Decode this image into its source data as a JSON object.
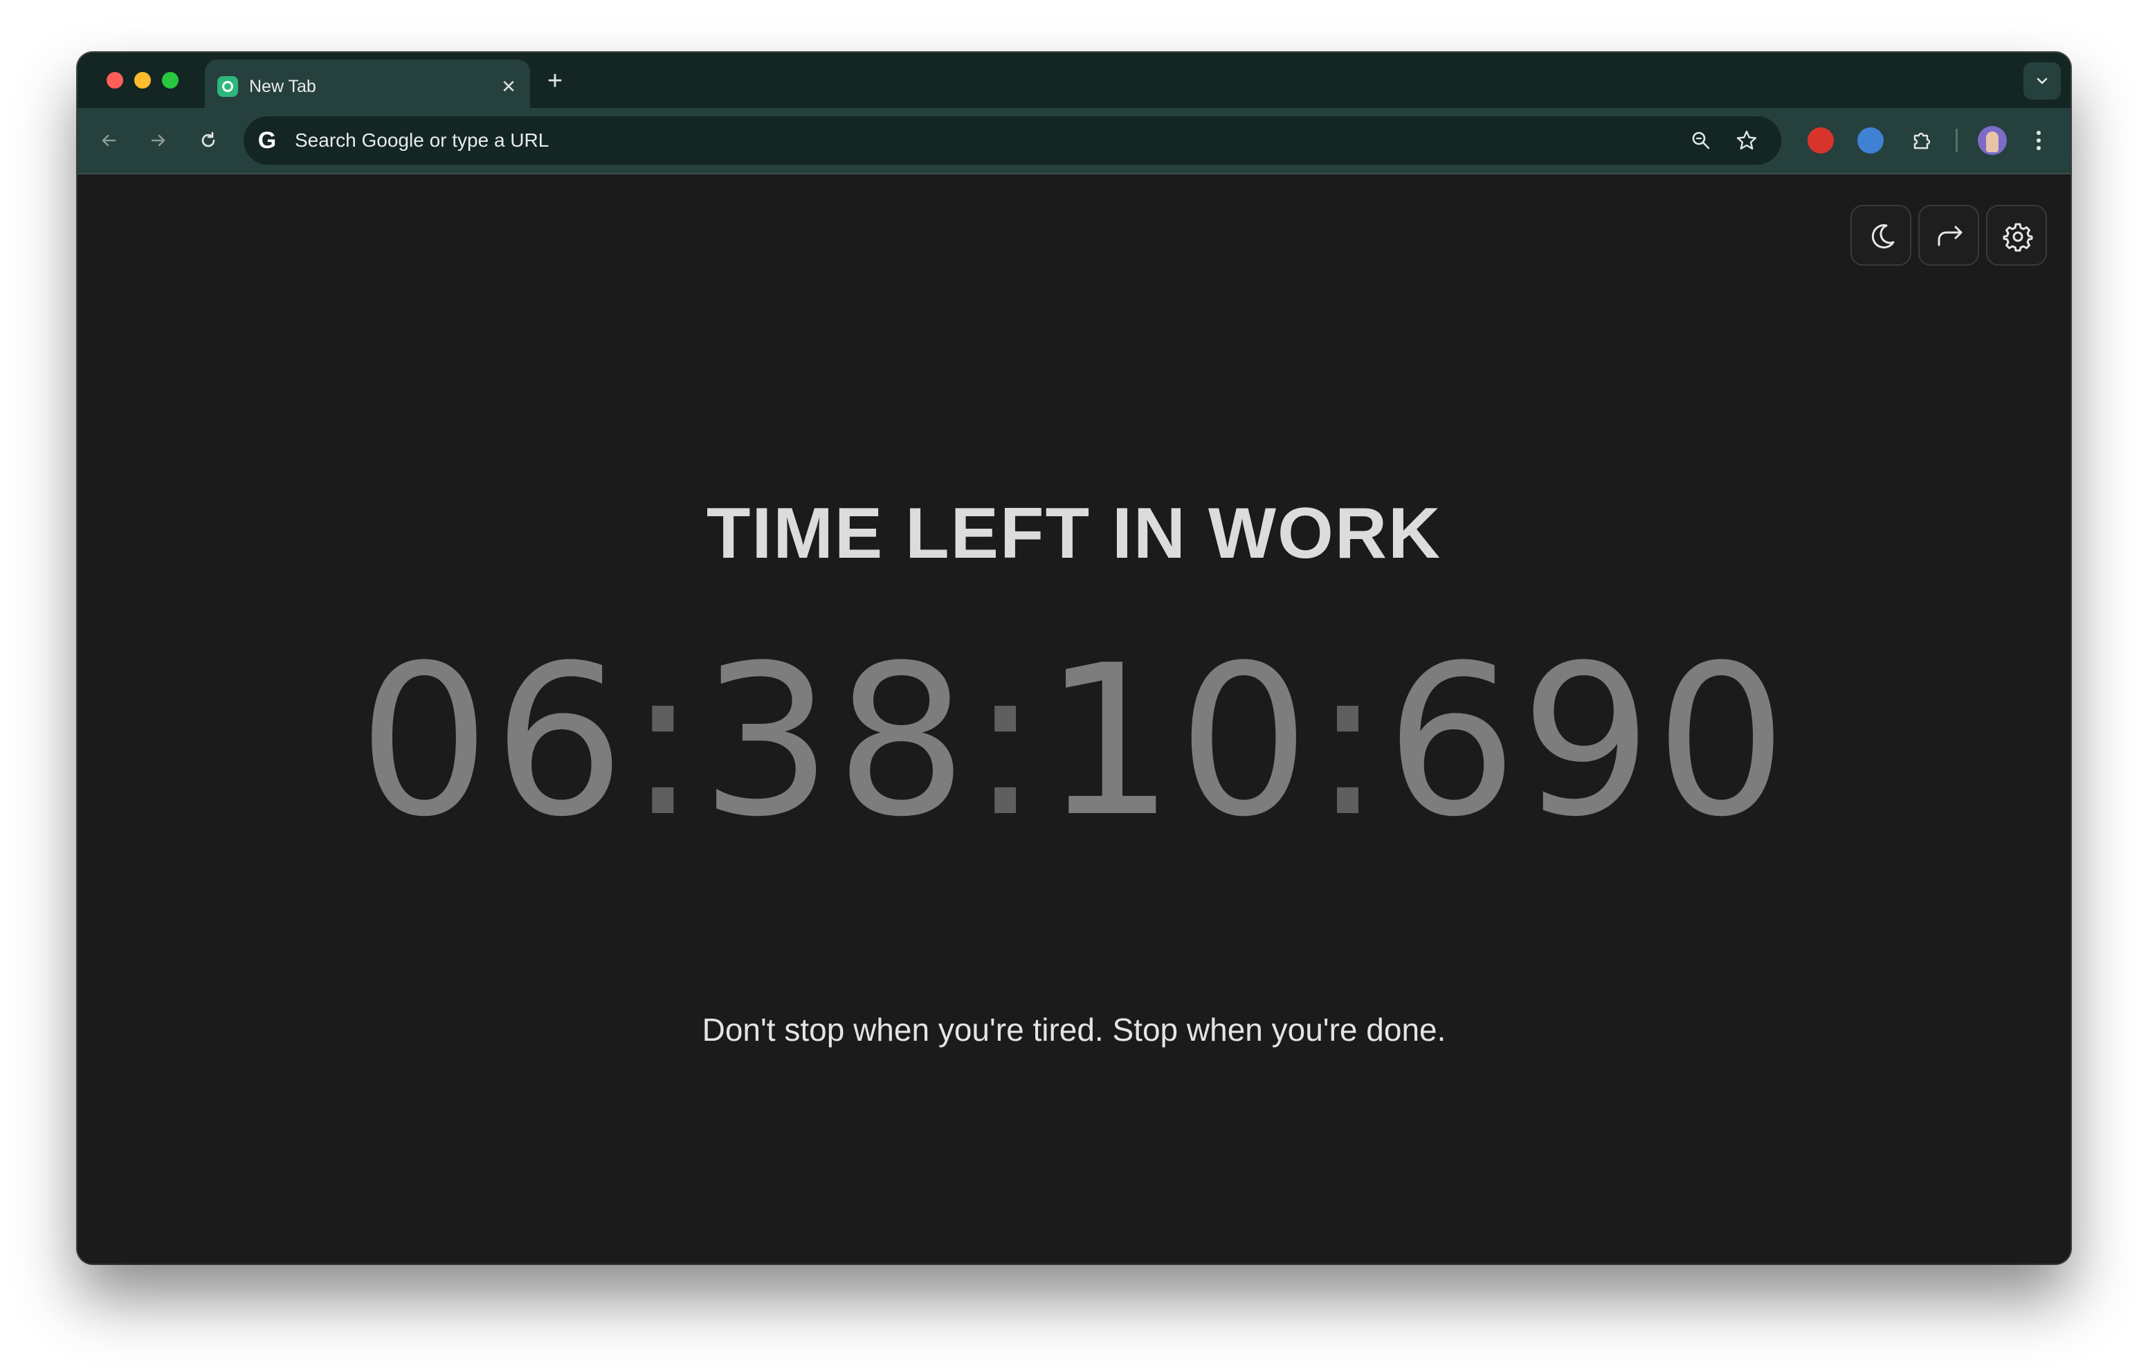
{
  "browser": {
    "tab": {
      "title": "New Tab",
      "close_glyph": "✕"
    },
    "new_tab_glyph": "+",
    "omnibox": {
      "text": "Search Google or type a URL",
      "logo": "G"
    },
    "icons": {
      "back": "back-arrow-icon",
      "forward": "forward-arrow-icon",
      "reload": "reload-icon",
      "zoom": "zoom-icon",
      "bookmark": "star-icon",
      "extension_red": "adblock-extension-icon",
      "extension_blue": "passwords-extension-icon",
      "extensions": "puzzle-icon",
      "menu": "kebab-menu-icon"
    },
    "colors": {
      "tabstrip": "#132624",
      "toolbar": "#26403d",
      "page_background": "#1b1b1b"
    }
  },
  "page": {
    "heading": "TIME LEFT IN WORK",
    "timer": {
      "hours": "06",
      "minutes": "38",
      "seconds": "10",
      "milliseconds": "690",
      "separator": ":"
    },
    "quote": "Don't stop when you're tired. Stop when you're done.",
    "controls": [
      "moon-icon",
      "redo-arrow-icon",
      "gear-icon"
    ]
  }
}
